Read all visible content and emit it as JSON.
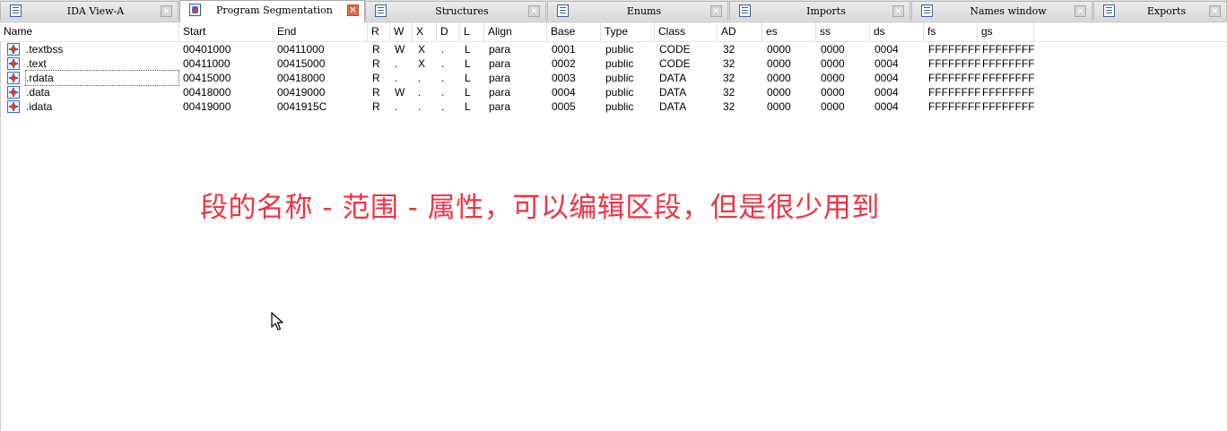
{
  "tabs": [
    {
      "label": "IDA View-A",
      "icon": "listing-icon",
      "active": false
    },
    {
      "label": "Program Segmentation",
      "icon": "segments-icon",
      "active": true
    },
    {
      "label": "Structures",
      "icon": "structures-icon",
      "active": false
    },
    {
      "label": "Enums",
      "icon": "enums-icon",
      "active": false
    },
    {
      "label": "Imports",
      "icon": "imports-icon",
      "active": false
    },
    {
      "label": "Names window",
      "icon": "names-icon",
      "active": false
    },
    {
      "label": "Exports",
      "icon": "exports-icon",
      "active": false
    }
  ],
  "columns": [
    "Name",
    "Start",
    "End",
    "R",
    "W",
    "X",
    "D",
    "L",
    "Align",
    "Base",
    "Type",
    "Class",
    "AD",
    "es",
    "ss",
    "ds",
    "fs",
    "gs"
  ],
  "segments": [
    {
      "name": ".textbss",
      "start": "00401000",
      "end": "00411000",
      "r": "R",
      "w": "W",
      "x": "X",
      "d": ".",
      "l": "L",
      "align": "para",
      "base": "0001",
      "type": "public",
      "class": "CODE",
      "ad": "32",
      "es": "0000",
      "ss": "0000",
      "ds": "0004",
      "fs": "FFFFFFFF",
      "gs": "FFFFFFFF"
    },
    {
      "name": ".text",
      "start": "00411000",
      "end": "00415000",
      "r": "R",
      "w": ".",
      "x": "X",
      "d": ".",
      "l": "L",
      "align": "para",
      "base": "0002",
      "type": "public",
      "class": "CODE",
      "ad": "32",
      "es": "0000",
      "ss": "0000",
      "ds": "0004",
      "fs": "FFFFFFFF",
      "gs": "FFFFFFFF"
    },
    {
      "name": ".rdata",
      "start": "00415000",
      "end": "00418000",
      "r": "R",
      "w": ".",
      "x": ".",
      "d": ".",
      "l": "L",
      "align": "para",
      "base": "0003",
      "type": "public",
      "class": "DATA",
      "ad": "32",
      "es": "0000",
      "ss": "0000",
      "ds": "0004",
      "fs": "FFFFFFFF",
      "gs": "FFFFFFFF"
    },
    {
      "name": ".data",
      "start": "00418000",
      "end": "00419000",
      "r": "R",
      "w": "W",
      "x": ".",
      "d": ".",
      "l": "L",
      "align": "para",
      "base": "0004",
      "type": "public",
      "class": "DATA",
      "ad": "32",
      "es": "0000",
      "ss": "0000",
      "ds": "0004",
      "fs": "FFFFFFFF",
      "gs": "FFFFFFFF"
    },
    {
      "name": ".idata",
      "start": "00419000",
      "end": "0041915C",
      "r": "R",
      "w": ".",
      "x": ".",
      "d": ".",
      "l": "L",
      "align": "para",
      "base": "0005",
      "type": "public",
      "class": "DATA",
      "ad": "32",
      "es": "0000",
      "ss": "0000",
      "ds": "0004",
      "fs": "FFFFFFFF",
      "gs": "FFFFFFFF"
    }
  ],
  "selected_row": 2,
  "annotation": "段的名称 - 范围 - 属性，可以编辑区段，但是很少用到",
  "colors": {
    "annotation": "#ee3344",
    "active_close": "#e06a4c"
  }
}
